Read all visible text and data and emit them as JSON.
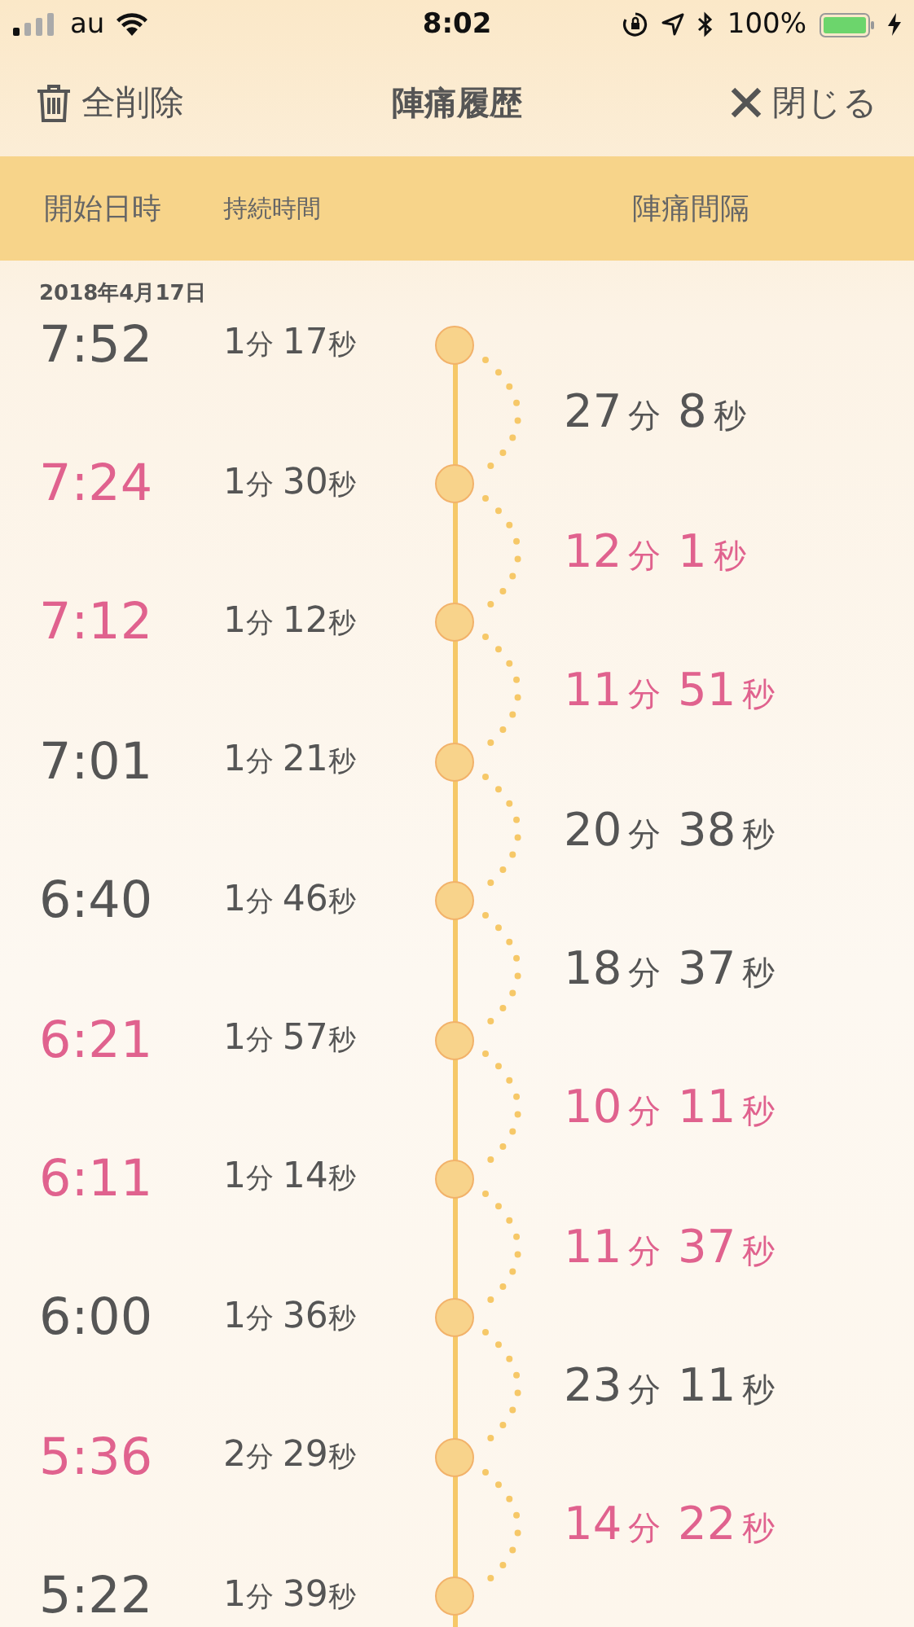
{
  "status_bar": {
    "carrier": "au",
    "time": "8:02",
    "battery": "100%"
  },
  "nav": {
    "clear_button": "全削除",
    "title": "陣痛履歴",
    "close_button": "閉じる"
  },
  "columns": [
    "開始日時",
    "持続時間",
    "陣痛間隔"
  ],
  "date": "2018年4月17日",
  "entries": [
    {
      "time": "7:52",
      "duration": "1分 17秒",
      "highlighted": false,
      "interval": {
        "text": "27分 8秒",
        "highlighted": false
      }
    },
    {
      "time": "7:24",
      "duration": "1分 30秒",
      "highlighted": true,
      "interval": {
        "text": "12分 1秒",
        "highlighted": true
      }
    },
    {
      "time": "7:12",
      "duration": "1分 12秒",
      "highlighted": true,
      "interval": {
        "text": "11分 51秒",
        "highlighted": true
      }
    },
    {
      "time": "7:01",
      "duration": "1分 21秒",
      "highlighted": false,
      "interval": {
        "text": "20分 38秒",
        "highlighted": false
      }
    },
    {
      "time": "6:40",
      "duration": "1分 46秒",
      "highlighted": false,
      "interval": {
        "text": "18分 37秒",
        "highlighted": false
      }
    },
    {
      "time": "6:21",
      "duration": "1分 57秒",
      "highlighted": true,
      "interval": {
        "text": "10分 11秒",
        "highlighted": true
      }
    },
    {
      "time": "6:11",
      "duration": "1分 14秒",
      "highlighted": true,
      "interval": {
        "text": "11分 37秒",
        "highlighted": true
      }
    },
    {
      "time": "6:00",
      "duration": "1分 36秒",
      "highlighted": false,
      "interval": {
        "text": "23分 11秒",
        "highlighted": false
      }
    },
    {
      "time": "5:36",
      "duration": "2分 29秒",
      "highlighted": true,
      "interval": {
        "text": "14分 22秒",
        "highlighted": true
      }
    },
    {
      "time": "5:22",
      "duration": "1分 39秒",
      "highlighted": false
    }
  ]
}
